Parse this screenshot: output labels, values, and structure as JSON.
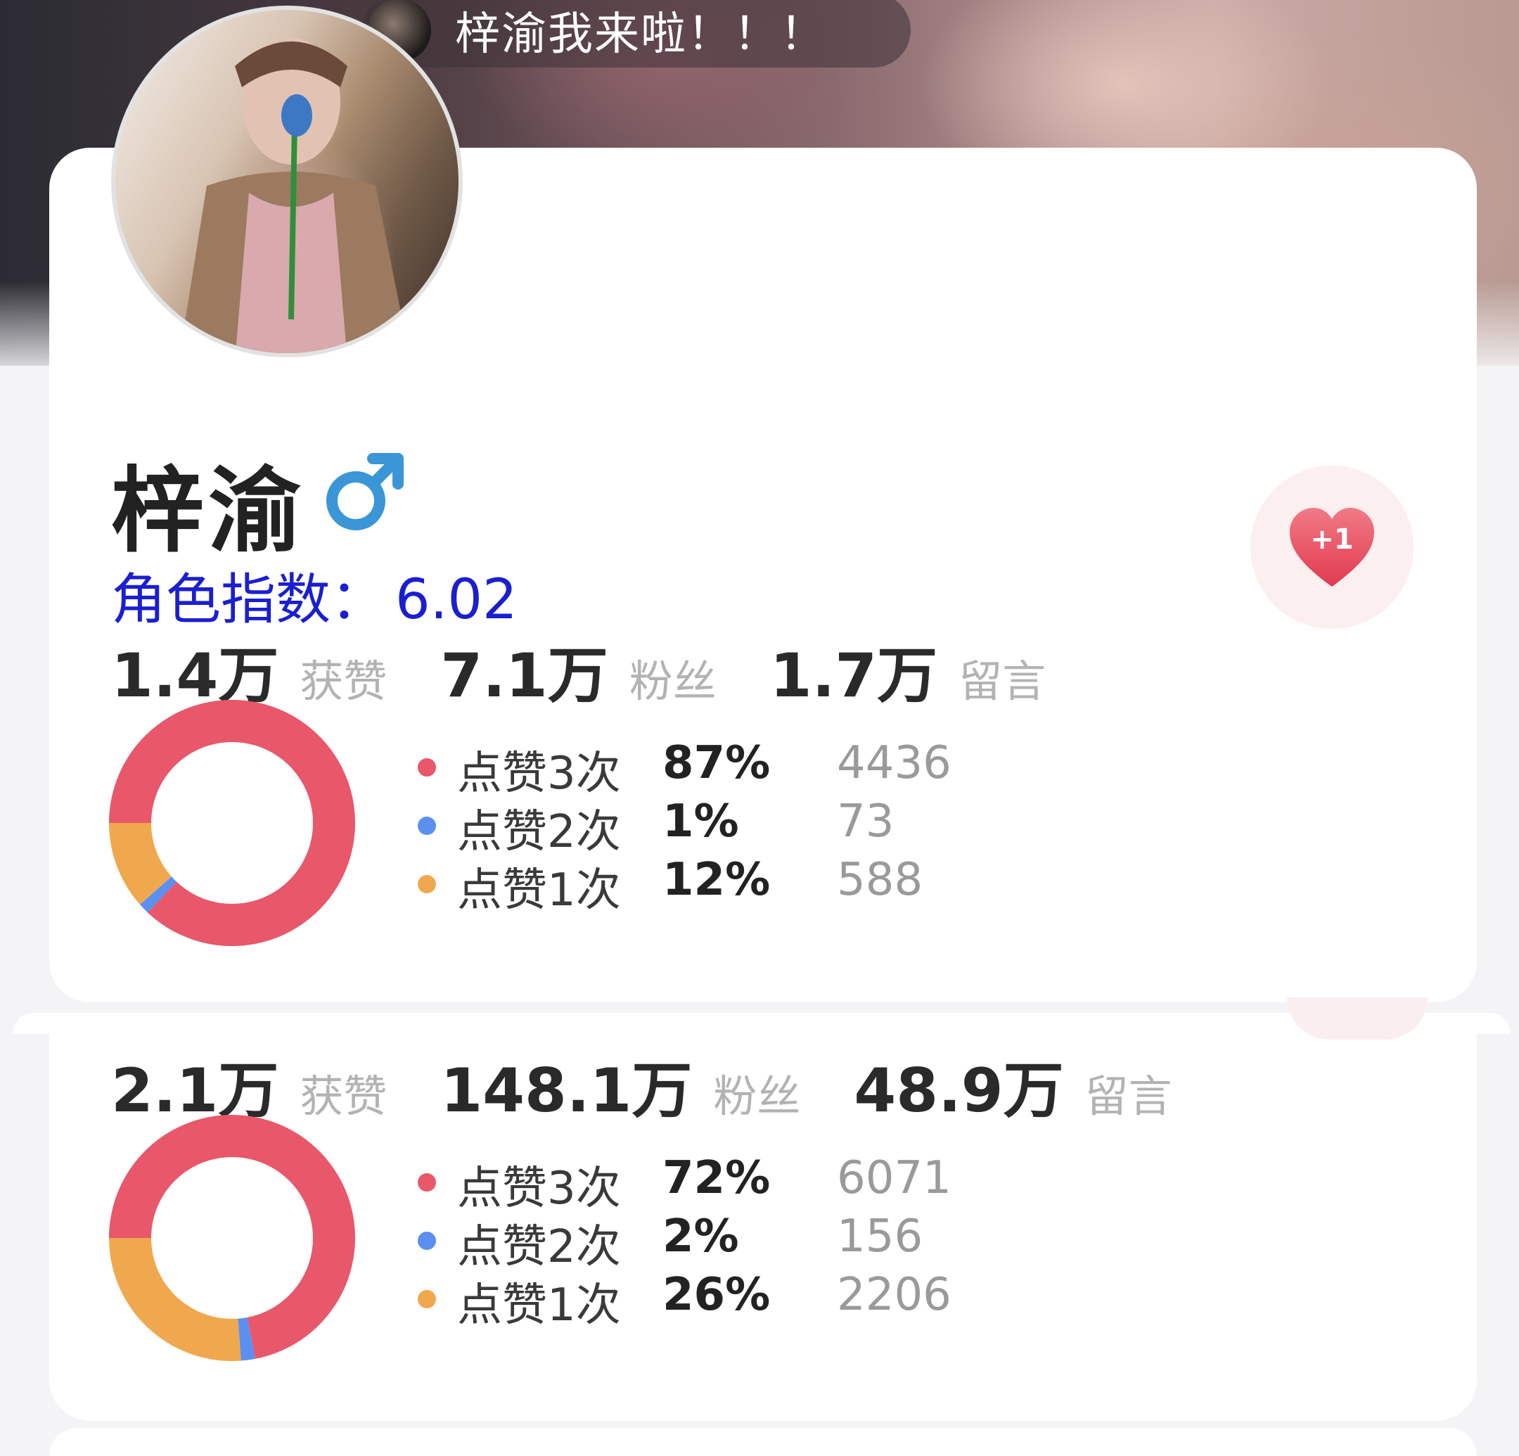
{
  "notification": {
    "text": "梓渝我来啦！！！"
  },
  "profile": {
    "name": "梓渝",
    "gender_icon": "male-symbol-icon",
    "index_label": "角色指数：",
    "index_value": "6.02",
    "like_button": {
      "label": "+1",
      "icon": "heart-icon"
    }
  },
  "colors": {
    "three_likes": "#e8576a",
    "two_likes": "#5b8ff0",
    "one_like": "#f0a84e",
    "index_text": "#1a1fd1",
    "gender": "#3a96d6"
  },
  "card1": {
    "stats": [
      {
        "value": "1.4万",
        "label": "获赞"
      },
      {
        "value": "7.1万",
        "label": "粉丝"
      },
      {
        "value": "1.7万",
        "label": "留言"
      }
    ],
    "breakdown": [
      {
        "label": "点赞3次",
        "percent": "87%",
        "count": "4436"
      },
      {
        "label": "点赞2次",
        "percent": "1%",
        "count": "73"
      },
      {
        "label": "点赞1次",
        "percent": "12%",
        "count": "588"
      }
    ]
  },
  "card2": {
    "stats": [
      {
        "value": "2.1万",
        "label": "获赞"
      },
      {
        "value": "148.1万",
        "label": "粉丝"
      },
      {
        "value": "48.9万",
        "label": "留言"
      }
    ],
    "breakdown": [
      {
        "label": "点赞3次",
        "percent": "72%",
        "count": "6071"
      },
      {
        "label": "点赞2次",
        "percent": "2%",
        "count": "156"
      },
      {
        "label": "点赞1次",
        "percent": "26%",
        "count": "2206"
      }
    ]
  },
  "chart_data": [
    {
      "type": "pie",
      "categories": [
        "点赞3次",
        "点赞2次",
        "点赞1次"
      ],
      "values": [
        4436,
        73,
        588
      ],
      "percent": [
        87,
        1,
        12
      ]
    },
    {
      "type": "pie",
      "categories": [
        "点赞3次",
        "点赞2次",
        "点赞1次"
      ],
      "values": [
        6071,
        156,
        2206
      ],
      "percent": [
        72,
        2,
        26
      ]
    }
  ]
}
